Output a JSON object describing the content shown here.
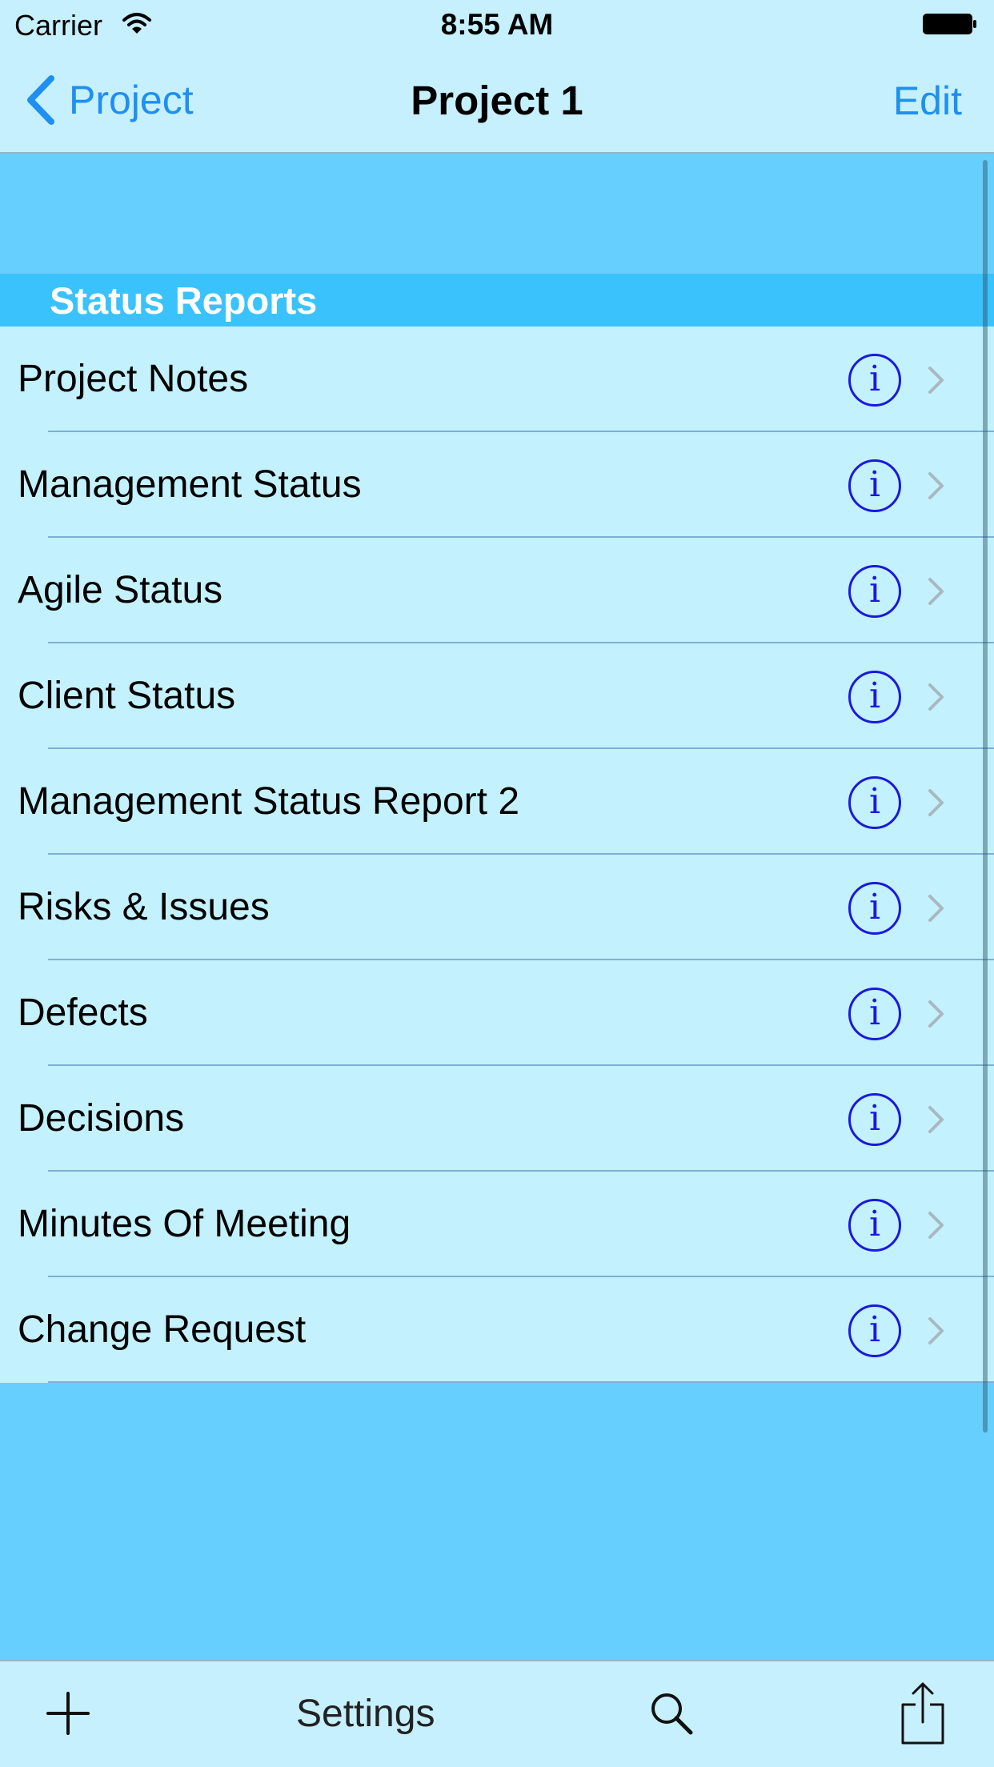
{
  "status_bar": {
    "carrier": "Carrier",
    "time": "8:55 AM"
  },
  "nav": {
    "back_label": "Project",
    "title": "Project 1",
    "edit_label": "Edit"
  },
  "section": {
    "title": "Status Reports"
  },
  "rows": [
    {
      "label": "Project Notes"
    },
    {
      "label": "Management Status"
    },
    {
      "label": "Agile Status"
    },
    {
      "label": "Client Status"
    },
    {
      "label": "Management Status Report 2"
    },
    {
      "label": "Risks & Issues"
    },
    {
      "label": "Defects"
    },
    {
      "label": "Decisions"
    },
    {
      "label": "Minutes Of Meeting"
    },
    {
      "label": "Change Request"
    }
  ],
  "info_glyph": "i",
  "toolbar": {
    "settings_label": "Settings"
  },
  "icons": {
    "back": "chevron-left-icon",
    "info": "info-circle-icon",
    "disclosure": "chevron-right-icon",
    "add": "plus-icon",
    "search": "magnifier-icon",
    "share": "share-icon"
  },
  "colors": {
    "background": "#66cffd",
    "bar": "#c6f0fe",
    "row": "#c4f1fe",
    "section_header": "#3ac2fd",
    "accent": "#1f8ff0",
    "info": "#1a1adb"
  }
}
